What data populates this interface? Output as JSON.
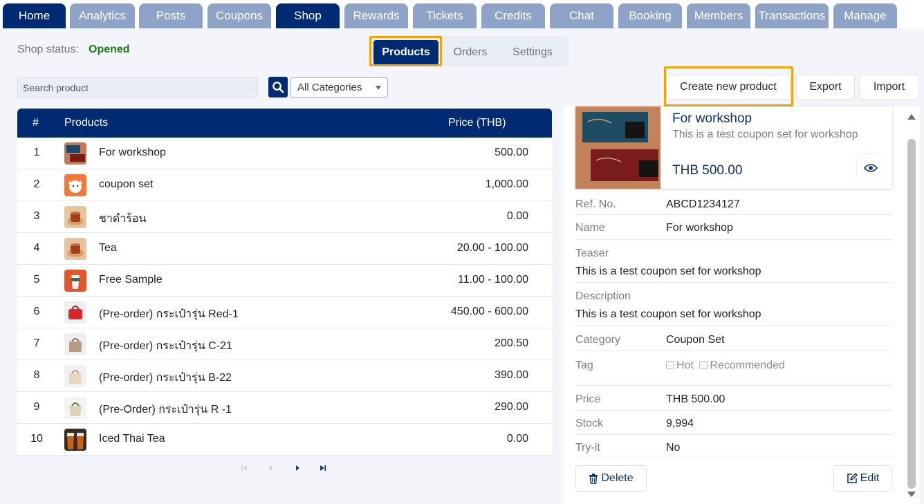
{
  "nav": {
    "tabs": [
      {
        "label": "Home",
        "active": false
      },
      {
        "label": "Analytics",
        "active": false
      },
      {
        "label": "Posts",
        "active": false
      },
      {
        "label": "Coupons",
        "active": false
      },
      {
        "label": "Shop",
        "active": true
      },
      {
        "label": "Rewards",
        "active": false
      },
      {
        "label": "Tickets",
        "active": false
      },
      {
        "label": "Credits",
        "active": false
      },
      {
        "label": "Chat",
        "active": false
      },
      {
        "label": "Booking",
        "active": false
      },
      {
        "label": "Members",
        "active": false
      },
      {
        "label": "Transactions",
        "active": false
      },
      {
        "label": "Manage",
        "active": false
      }
    ]
  },
  "shop": {
    "status_label": "Shop status:",
    "status_value": "Opened"
  },
  "subtabs": [
    {
      "label": "Products",
      "active": true
    },
    {
      "label": "Orders",
      "active": false
    },
    {
      "label": "Settings",
      "active": false
    }
  ],
  "toolbar": {
    "search_placeholder": "Search product",
    "category_value": "All Categories",
    "create_label": "Create new product",
    "export_label": "Export",
    "import_label": "Import"
  },
  "table": {
    "headers": {
      "num": "#",
      "product": "Products",
      "price": "Price (THB)"
    },
    "rows": [
      {
        "num": "1",
        "name": "For workshop",
        "price": "500.00",
        "thumb": "coupon-card-image"
      },
      {
        "num": "2",
        "name": "coupon set",
        "price": "1,000.00",
        "thumb": "fox-mascot-image"
      },
      {
        "num": "3",
        "name": "ชาดำร้อน",
        "price": "0.00",
        "thumb": "tea-cup-image"
      },
      {
        "num": "4",
        "name": "Tea",
        "price": "20.00 - 100.00",
        "thumb": "tea-cup-image"
      },
      {
        "num": "5",
        "name": "Free Sample",
        "price": "11.00 - 100.00",
        "thumb": "drink-cup-image"
      },
      {
        "num": "6",
        "name": "(Pre-order) กระเป๋ารุ่น Red-1",
        "price": "450.00 - 600.00",
        "thumb": "red-bag-image"
      },
      {
        "num": "7",
        "name": "(Pre-order) กระเป๋ารุ่น C-21",
        "price": "200.50",
        "thumb": "tan-bag-image"
      },
      {
        "num": "8",
        "name": "(Pre-order) กระเป๋ารุ่น B-22",
        "price": "390.00",
        "thumb": "cream-bag-image"
      },
      {
        "num": "9",
        "name": "(Pre-Order) กระเป๋ารุ่น R -1",
        "price": "290.00",
        "thumb": "tote-bag-image"
      },
      {
        "num": "10",
        "name": "Iced Thai Tea",
        "price": "0.00",
        "thumb": "iced-tea-image"
      }
    ]
  },
  "detail": {
    "title": "For workshop",
    "teaser": "This is a test coupon set for workshop",
    "price_display": "THB 500.00",
    "fields": {
      "ref_label": "Ref. No.",
      "ref_value": "ABCD1234127",
      "name_label": "Name",
      "name_value": "For workshop",
      "teaser_label": "Teaser",
      "teaser_value": "This is a test coupon set for workshop",
      "description_label": "Description",
      "description_value": "This is a test coupon set for workshop",
      "category_label": "Category",
      "category_value": "Coupon Set",
      "tag_label": "Tag",
      "tag_hot": "Hot",
      "tag_recommended": "Recommended",
      "price_label": "Price",
      "price_value": "THB 500.00",
      "stock_label": "Stock",
      "stock_value": "9,994",
      "tryit_label": "Try-it",
      "tryit_value": "No"
    },
    "delete_label": "Delete",
    "edit_label": "Edit"
  },
  "colors": {
    "brand": "#002a72",
    "tab_inactive": "#8ea3c7",
    "status_open": "#1c7a1c",
    "highlight": "#f5a300"
  }
}
